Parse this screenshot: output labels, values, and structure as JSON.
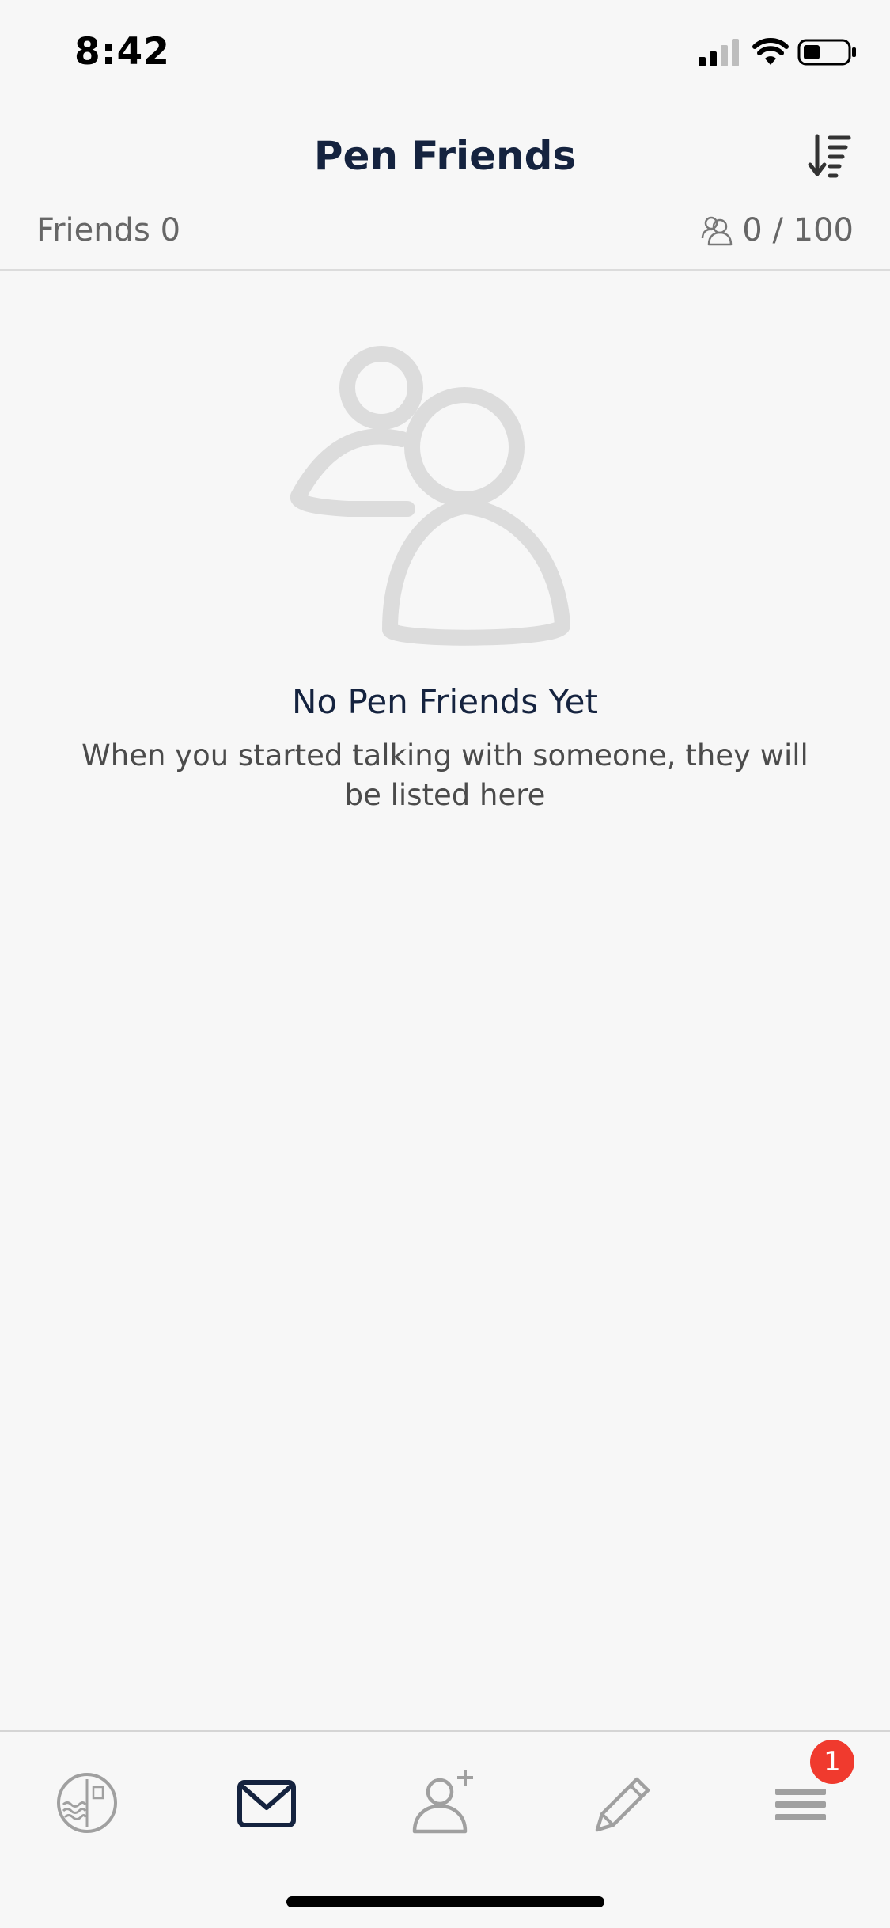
{
  "status_bar": {
    "time": "8:42",
    "icons": [
      "cellular-signal-icon",
      "wifi-icon",
      "battery-icon"
    ]
  },
  "header": {
    "title": "Pen Friends",
    "sort_icon": "sort-descending-icon"
  },
  "friends_bar": {
    "friends_label": "Friends 0",
    "capacity_icon": "friends-group-icon",
    "capacity_text": "0 / 100"
  },
  "empty_state": {
    "illustration": "friends-group-icon",
    "title": "No Pen Friends Yet",
    "description": "When you started talking with someone, they will be listed here"
  },
  "tab_bar": {
    "tabs": [
      {
        "name": "stamp-tab",
        "icon": "stamp-icon"
      },
      {
        "name": "letters-tab",
        "icon": "envelope-icon",
        "active": true
      },
      {
        "name": "add-friend-tab",
        "icon": "add-user-icon"
      },
      {
        "name": "write-tab",
        "icon": "pencil-icon"
      },
      {
        "name": "menu-tab",
        "icon": "menu-icon",
        "badge": "1"
      }
    ]
  },
  "colors": {
    "background": "#f7f7f7",
    "title": "#15233f",
    "muted_text": "#666666",
    "icon_gray": "#a0a0a0",
    "illustration_gray": "#dcdcdc",
    "badge": "#f03a2e",
    "active_tab": "#15233f"
  }
}
